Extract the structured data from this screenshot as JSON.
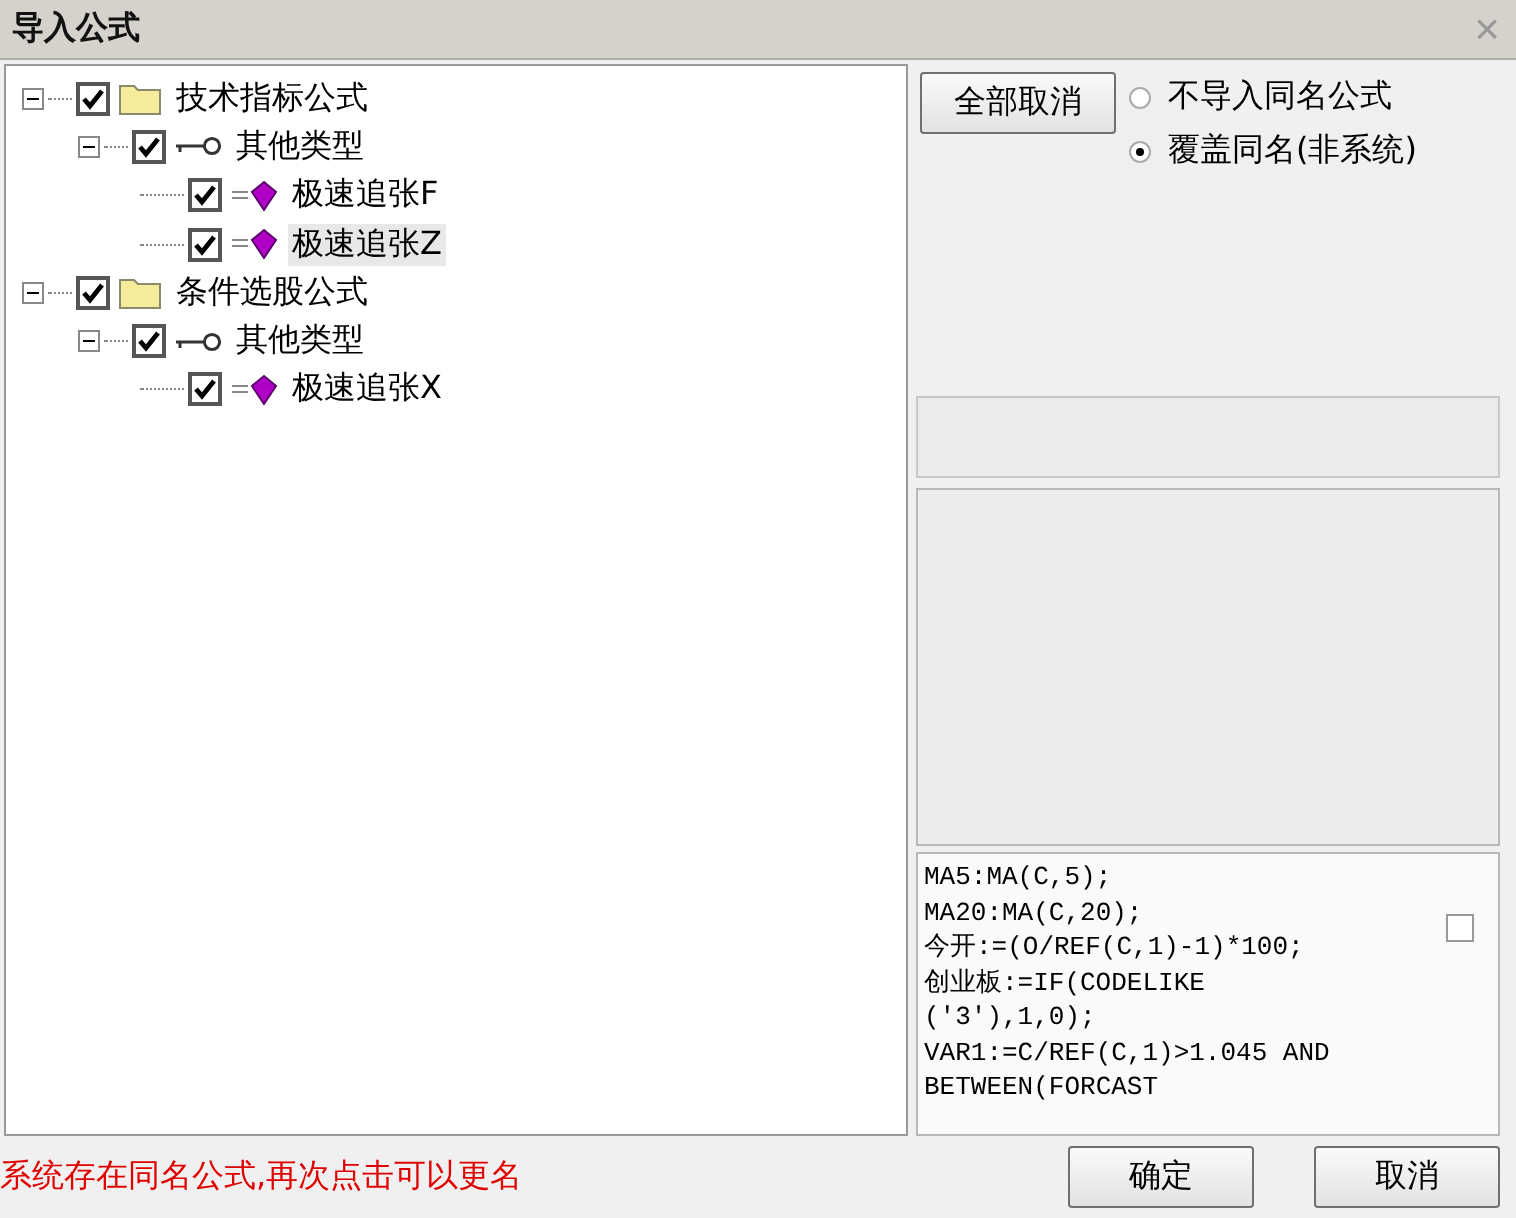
{
  "window": {
    "title": "导入公式",
    "close": "×"
  },
  "tree": [
    {
      "kind": "folder",
      "label": "技术指标公式",
      "checked": true,
      "expanded": true,
      "selected": false,
      "children": [
        {
          "kind": "type",
          "label": "其他类型",
          "checked": true,
          "expanded": true,
          "selected": false,
          "children": [
            {
              "kind": "formula",
              "label": "极速追张F",
              "checked": true,
              "selected": false
            },
            {
              "kind": "formula",
              "label": "极速追张Z",
              "checked": true,
              "selected": true
            }
          ]
        }
      ]
    },
    {
      "kind": "folder",
      "label": "条件选股公式",
      "checked": true,
      "expanded": true,
      "selected": false,
      "children": [
        {
          "kind": "type",
          "label": "其他类型",
          "checked": true,
          "expanded": true,
          "selected": false,
          "children": [
            {
              "kind": "formula",
              "label": "极速追张X",
              "checked": true,
              "selected": false
            }
          ]
        }
      ]
    }
  ],
  "deselect_button": "全部取消",
  "options": [
    {
      "label": "不导入同名公式",
      "selected": false
    },
    {
      "label": "覆盖同名(非系统)",
      "selected": true
    }
  ],
  "code": {
    "lines": [
      "MA5:MA(C,5);",
      "MA20:MA(C,20);",
      "今开:=(O/REF(C,1)-1)*100;",
      "创业板:=IF(CODELIKE",
      "('3'),1,0);",
      "VAR1:=C/REF(C,1)>1.045 AND",
      "BETWEEN(FORCAST"
    ],
    "checked": false
  },
  "status_message": "系统存在同名公式,再次点击可以更名",
  "buttons": [
    "确定",
    "取消"
  ]
}
